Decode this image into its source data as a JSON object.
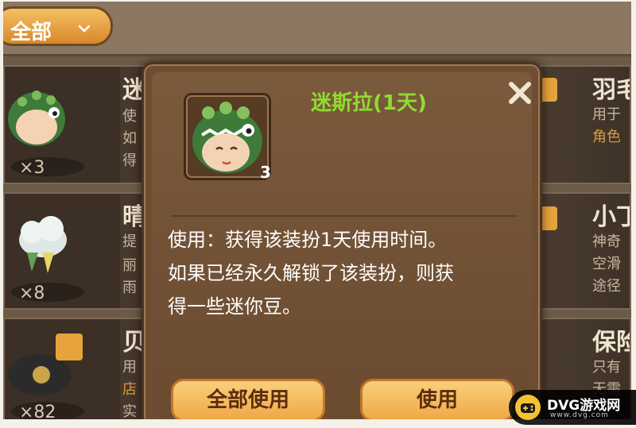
{
  "filter": {
    "label": "全部"
  },
  "list": {
    "left": [
      {
        "title": "迷",
        "lines": [
          "使",
          "如",
          "得"
        ],
        "count": "×3"
      },
      {
        "title": "晴",
        "lines": [
          "提",
          "丽",
          "雨"
        ],
        "count": "×8"
      },
      {
        "title": "贝",
        "lines": [
          "用",
          "店",
          "实"
        ],
        "count": "×82"
      }
    ],
    "right": [
      {
        "title": "羽毛",
        "lines": [
          "用于",
          "角色"
        ]
      },
      {
        "title": "小丁",
        "lines": [
          "神奇",
          "空滑",
          "途径"
        ]
      },
      {
        "title": "保险",
        "lines": [
          "只有",
          "无需"
        ]
      }
    ]
  },
  "dialog": {
    "title": "迷斯拉(1天)",
    "item_quantity": "3",
    "description_lines": [
      "使用：获得该装扮1天使用时间。",
      "如果已经永久解锁了该装扮，则获",
      "得一些迷你豆。"
    ],
    "use_all_label": "全部使用",
    "use_label": "使用"
  },
  "watermark": {
    "text": "DVG游戏网",
    "url": "www.dvg.com"
  }
}
